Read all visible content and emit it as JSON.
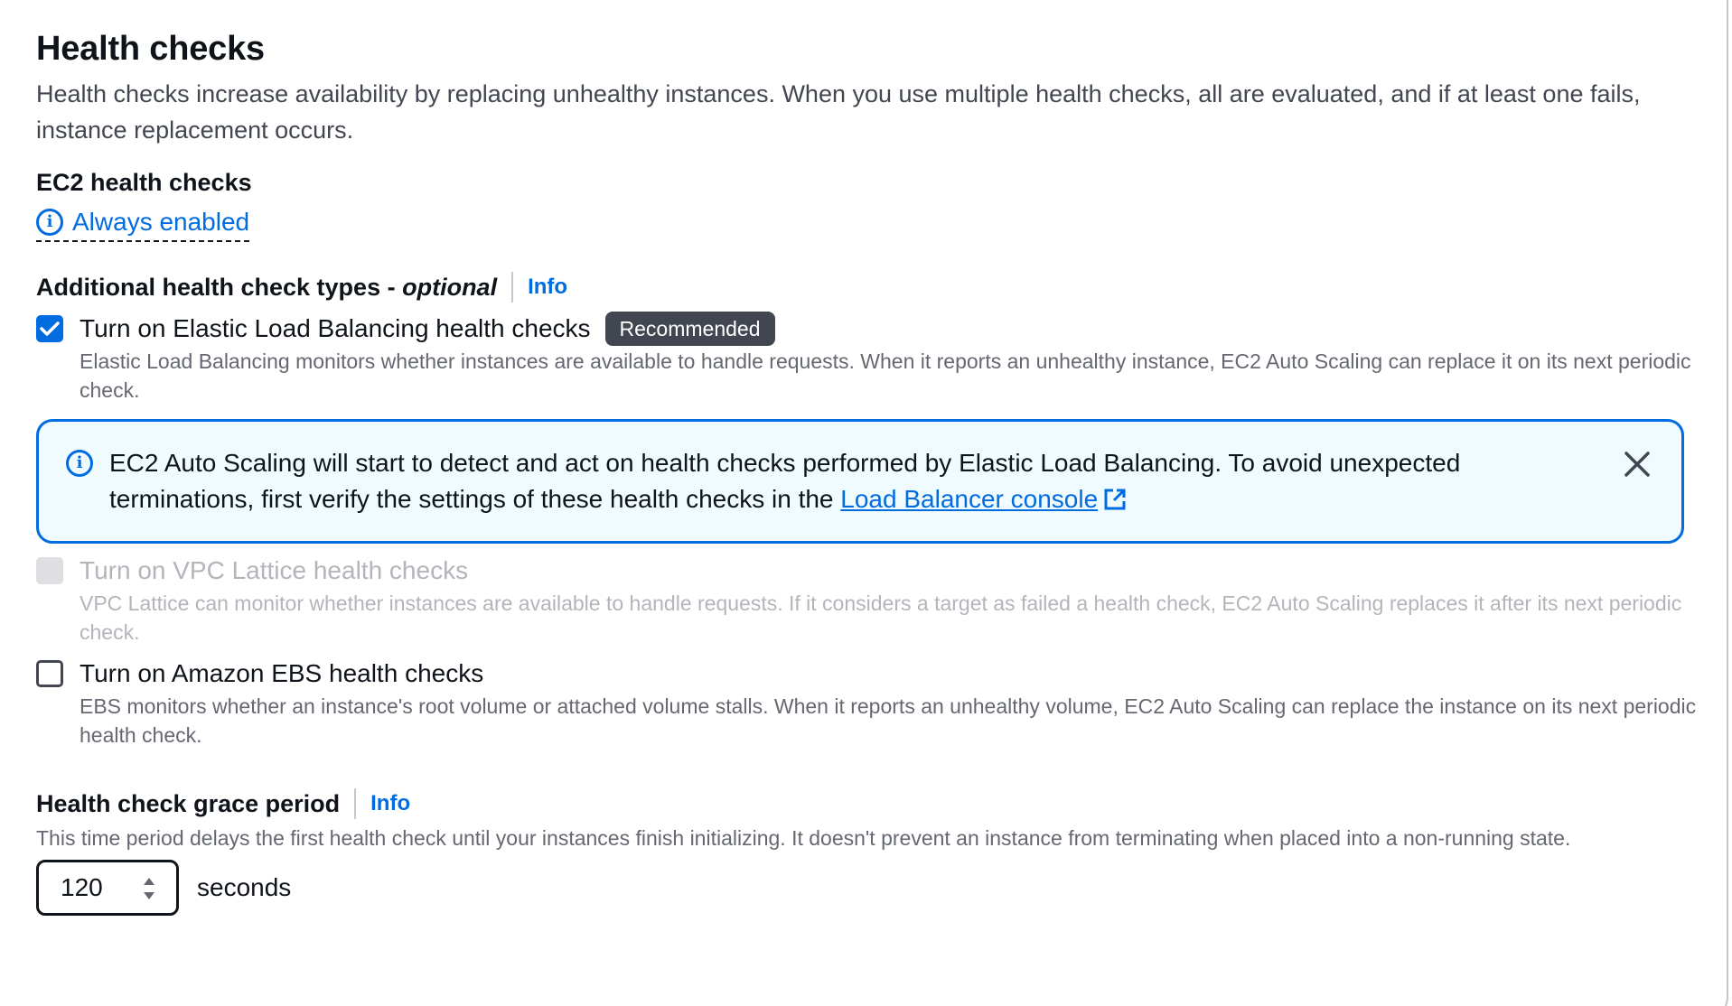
{
  "section": {
    "title": "Health checks",
    "description": "Health checks increase availability by replacing unhealthy instances. When you use multiple health checks, all are evaluated, and if at least one fails, instance replacement occurs."
  },
  "ec2": {
    "label": "EC2 health checks",
    "status": "Always enabled"
  },
  "additional": {
    "label": "Additional health check types - ",
    "optional": "optional",
    "info": "Info",
    "options": [
      {
        "title": "Turn on Elastic Load Balancing health checks",
        "badge": "Recommended",
        "description": "Elastic Load Balancing monitors whether instances are available to handle requests. When it reports an unhealthy instance, EC2 Auto Scaling can replace it on its next periodic check.",
        "checked": true,
        "disabled": false
      },
      {
        "title": "Turn on VPC Lattice health checks",
        "description": "VPC Lattice can monitor whether instances are available to handle requests. If it considers a target as failed a health check, EC2 Auto Scaling replaces it after its next periodic check.",
        "checked": false,
        "disabled": true
      },
      {
        "title": "Turn on Amazon EBS health checks",
        "description": "EBS monitors whether an instance's root volume or attached volume stalls. When it reports an unhealthy volume, EC2 Auto Scaling can replace the instance on its next periodic health check.",
        "checked": false,
        "disabled": false
      }
    ]
  },
  "alert": {
    "text": "EC2 Auto Scaling will start to detect and act on health checks performed by Elastic Load Balancing. To avoid unexpected terminations, first verify the settings of these health checks in the ",
    "link": "Load Balancer console"
  },
  "grace": {
    "label": "Health check grace period",
    "info": "Info",
    "description": "This time period delays the first health check until your instances finish initializing. It doesn't prevent an instance from terminating when placed into a non-running state.",
    "value": "120",
    "unit": "seconds"
  },
  "colors": {
    "accent": "#006ce0",
    "alert_bg": "#f0fbff",
    "badge_bg": "#424650",
    "text": "#0f141a",
    "muted": "#656871",
    "disabled": "#b4b4bb"
  },
  "icons": {
    "info": "info-circle-icon",
    "close": "close-icon",
    "external": "external-link-icon",
    "check": "check-icon",
    "spinner": "spinner-arrows-icon"
  }
}
